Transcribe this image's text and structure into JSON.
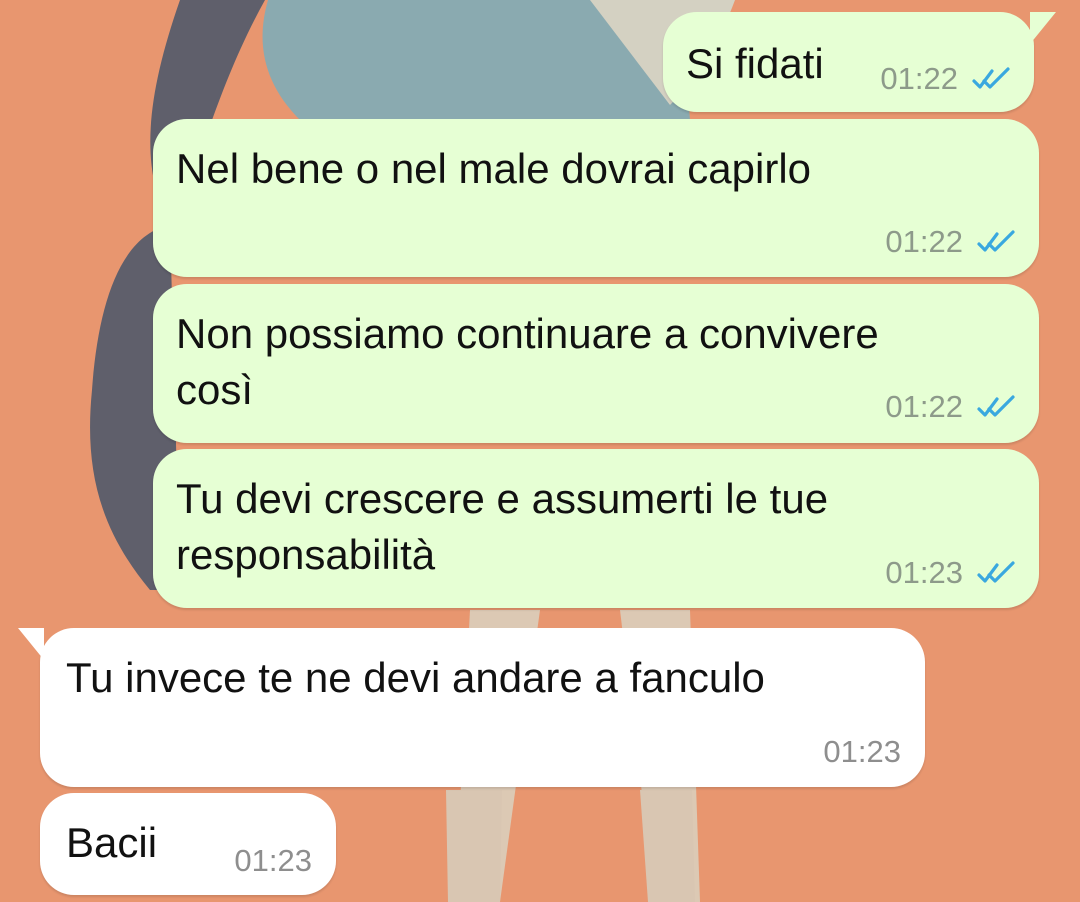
{
  "chat": {
    "messages": [
      {
        "id": "msg-1",
        "direction": "outgoing",
        "text": "Si fidati",
        "time": "01:22",
        "status_icon": "double-check-icon"
      },
      {
        "id": "msg-2",
        "direction": "outgoing",
        "text": "Nel bene o nel male dovrai capirlo",
        "time": "01:22",
        "status_icon": "double-check-icon"
      },
      {
        "id": "msg-3",
        "direction": "outgoing",
        "text": "Non possiamo continuare a convivere\ncosì",
        "time": "01:22",
        "status_icon": "double-check-icon"
      },
      {
        "id": "msg-4",
        "direction": "outgoing",
        "text": "Tu devi crescere e assumerti le tue\nresponsabilità",
        "time": "01:23",
        "status_icon": "double-check-icon"
      },
      {
        "id": "msg-5",
        "direction": "incoming",
        "text": "Tu invece te ne devi andare a fanculo",
        "time": "01:23"
      },
      {
        "id": "msg-6",
        "direction": "incoming",
        "text": "Bacii",
        "time": "01:23"
      }
    ]
  },
  "colors": {
    "background": "#e8966f",
    "outgoing_bubble": "#e6ffd4",
    "incoming_bubble": "#ffffff",
    "read_ticks": "#3aa8df"
  }
}
